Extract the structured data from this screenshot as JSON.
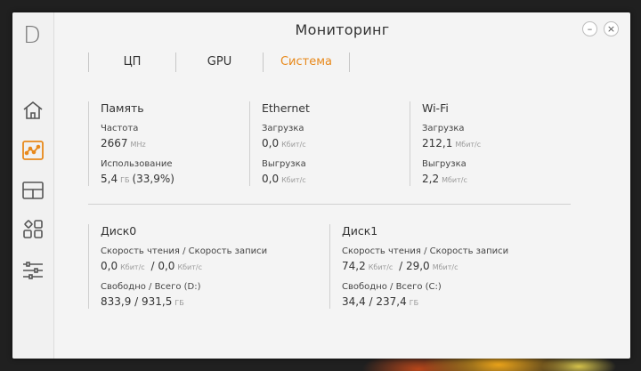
{
  "app": {
    "logo": "D",
    "title": "Мониторинг",
    "minimize_label": "–",
    "close_label": "×"
  },
  "sidebar": {
    "items": [
      {
        "name": "home",
        "icon": "home-icon",
        "active": false
      },
      {
        "name": "monitoring",
        "icon": "monitor-graph-icon",
        "active": true
      },
      {
        "name": "layout",
        "icon": "layout-icon",
        "active": false
      },
      {
        "name": "apps",
        "icon": "apps-grid-icon",
        "active": false
      },
      {
        "name": "settings",
        "icon": "sliders-icon",
        "active": false
      }
    ]
  },
  "tabs": [
    {
      "label": "ЦП",
      "active": false
    },
    {
      "label": "GPU",
      "active": false
    },
    {
      "label": "Система",
      "active": true
    }
  ],
  "memory": {
    "title": "Память",
    "freq_label": "Частота",
    "freq_value": "2667",
    "freq_unit": "MHz",
    "usage_label": "Использование",
    "usage_value": "5,4",
    "usage_unit": "ГБ",
    "usage_percent": "(33,9%)"
  },
  "ethernet": {
    "title": "Ethernet",
    "down_label": "Загрузка",
    "down_value": "0,0",
    "down_unit": "Кбит/с",
    "up_label": "Выгрузка",
    "up_value": "0,0",
    "up_unit": "Кбит/с"
  },
  "wifi": {
    "title": "Wi-Fi",
    "down_label": "Загрузка",
    "down_value": "212,1",
    "down_unit": "Мбит/с",
    "up_label": "Выгрузка",
    "up_value": "2,2",
    "up_unit": "Мбит/с"
  },
  "disk0": {
    "title": "Диск0",
    "speed_label": "Скорость чтения / Скорость записи",
    "read_value": "0,0",
    "read_unit": "Кбит/с",
    "write_value": "0,0",
    "write_unit": "Кбит/с",
    "space_label": "Свободно / Всего (D:)",
    "free_value": "833,9",
    "total_value": "931,5",
    "space_unit": "ГБ"
  },
  "disk1": {
    "title": "Диск1",
    "speed_label": "Скорость чтения / Скорость записи",
    "read_value": "74,2",
    "read_unit": "Кбит/с",
    "write_value": "29,0",
    "write_unit": "Мбит/с",
    "space_label": "Свободно / Всего (C:)",
    "free_value": "34,4",
    "total_value": "237,4",
    "space_unit": "ГБ"
  },
  "colors": {
    "accent": "#e8891b",
    "background": "#f4f4f4",
    "text": "#333333"
  }
}
